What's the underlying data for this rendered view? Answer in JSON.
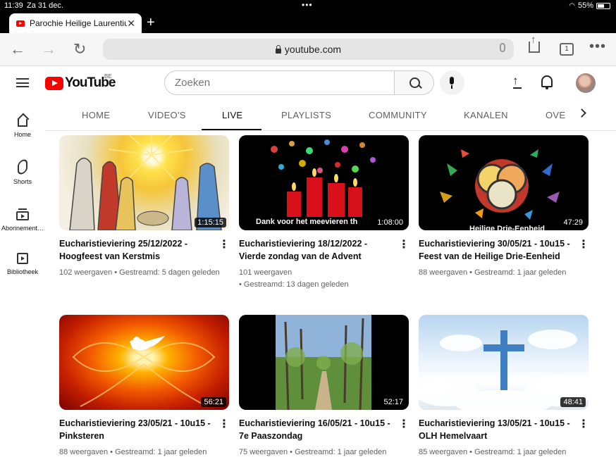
{
  "status": {
    "time": "11:39",
    "date": "Za 31 dec.",
    "battery": "55%"
  },
  "browser": {
    "tab_title": "Parochie Heilige Laurentius",
    "url": "youtube.com",
    "tab_count": "1"
  },
  "youtube": {
    "logo_text": "YouTube",
    "country": "BE",
    "search_placeholder": "Zoeken"
  },
  "sidebar": {
    "items": [
      {
        "label": "Home",
        "icon": "home-icon"
      },
      {
        "label": "Shorts",
        "icon": "shorts-icon"
      },
      {
        "label": "Abonnement…",
        "icon": "subscriptions-icon"
      },
      {
        "label": "Bibliotheek",
        "icon": "library-icon"
      }
    ]
  },
  "channel_tabs": {
    "items": [
      {
        "label": "HOME"
      },
      {
        "label": "VIDEO'S"
      },
      {
        "label": "LIVE",
        "active": true
      },
      {
        "label": "PLAYLISTS"
      },
      {
        "label": "COMMUNITY"
      },
      {
        "label": "KANALEN"
      },
      {
        "label": "OVE"
      }
    ]
  },
  "videos": [
    {
      "title": "Eucharistieviering 25/12/2022 - Hoogfeest van Kerstmis",
      "meta_line1": "102 weergaven • Gestreamd: 5 dagen geleden",
      "meta_line2": "",
      "duration": "1:15:15",
      "overlay_text": ""
    },
    {
      "title": "Eucharistieviering 18/12/2022 - Vierde zondag van de Advent",
      "meta_line1": "101 weergaven",
      "meta_line2": "• Gestreamd: 13 dagen geleden",
      "duration": "1:08:00",
      "overlay_text": "Dank voor het meevieren th"
    },
    {
      "title": "Eucharistieviering 30/05/21 - 10u15 - Feest van de Heilige Drie-Eenheid",
      "meta_line1": "88 weergaven • Gestreamd: 1 jaar geleden",
      "meta_line2": "",
      "duration": "47:29",
      "overlay_text": "Heilige Drie-Eenheid"
    },
    {
      "title": "Eucharistieviering 23/05/21 - 10u15 - Pinksteren",
      "meta_line1": "88 weergaven • Gestreamd: 1 jaar geleden",
      "meta_line2": "",
      "duration": "56:21",
      "overlay_text": ""
    },
    {
      "title": "Eucharistieviering 16/05/21 - 10u15 - 7e Paaszondag",
      "meta_line1": "75 weergaven • Gestreamd: 1 jaar geleden",
      "meta_line2": "",
      "duration": "52:17",
      "overlay_text": ""
    },
    {
      "title": "Eucharistieviering 13/05/21 - 10u15 - OLH Hemelvaart",
      "meta_line1": "85 weergaven • Gestreamd: 1 jaar geleden",
      "meta_line2": "",
      "duration": "48:41",
      "overlay_text": ""
    }
  ],
  "colors": {
    "brand_red": "#ff0000",
    "text_primary": "#0f0f0f",
    "text_secondary": "#606060"
  }
}
